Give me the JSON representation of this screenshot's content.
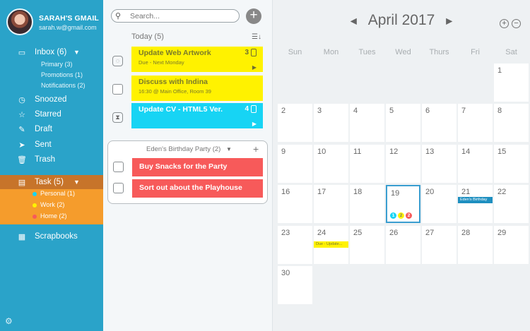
{
  "profile": {
    "name": "SARAH'S GMAIL",
    "email": "sarah.w@gmail.com"
  },
  "sidebar": {
    "inbox": "Inbox (6)",
    "inbox_subs": [
      "Primary (3)",
      "Promotions (1)",
      "Notifications (2)"
    ],
    "items": [
      "Snoozed",
      "Starred",
      "Draft",
      "Sent",
      "Trash"
    ],
    "task": "Task (5)",
    "task_tags": [
      {
        "label": "Personal (1)",
        "color": "#17d4f4"
      },
      {
        "label": "Work (2)",
        "color": "#fff200"
      },
      {
        "label": "Home (2)",
        "color": "#f75a5a"
      }
    ],
    "scrapbooks": "Scrapbooks"
  },
  "tasks": {
    "search_placeholder": "Search...",
    "today": "Today (5)",
    "items": [
      {
        "title": "Update Web Artwork",
        "meta": "Due - Next Monday",
        "count": "3",
        "color": "yellow"
      },
      {
        "title": "Discuss with Indina",
        "meta": "16:30 @ Main Office, Room 39",
        "count": "",
        "color": "yellow"
      },
      {
        "title": "Update CV - HTML5 Ver.",
        "meta": "",
        "count": "4",
        "color": "cyan"
      }
    ],
    "group": {
      "title": "Eden's Birthday Party (2)",
      "items": [
        "Buy Snacks for the Party",
        "Sort out about the Playhouse"
      ]
    }
  },
  "calendar": {
    "month": "April 2017",
    "days_of_week": [
      "Sun",
      "Mon",
      "Tues",
      "Wed",
      "Thurs",
      "Fri",
      "Sat"
    ],
    "dates": [
      "1",
      "2",
      "3",
      "4",
      "5",
      "6",
      "7",
      "8",
      "9",
      "10",
      "11",
      "12",
      "13",
      "14",
      "15",
      "16",
      "17",
      "18",
      "19",
      "20",
      "21",
      "22",
      "23",
      "24",
      "25",
      "26",
      "27",
      "28",
      "29",
      "30"
    ],
    "badges": [
      "1",
      "2",
      "2"
    ],
    "events": {
      "birthday": "Eden's Birthday",
      "due": "Due - Update..."
    }
  },
  "colors": {
    "sidebar": "#2aa3c9",
    "task_band": "#c7742a",
    "task_sub_band": "#f59c2c",
    "yellow": "#fff200",
    "cyan": "#17d4f4",
    "red": "#f75a5a",
    "selected": "#3a9ed0"
  }
}
